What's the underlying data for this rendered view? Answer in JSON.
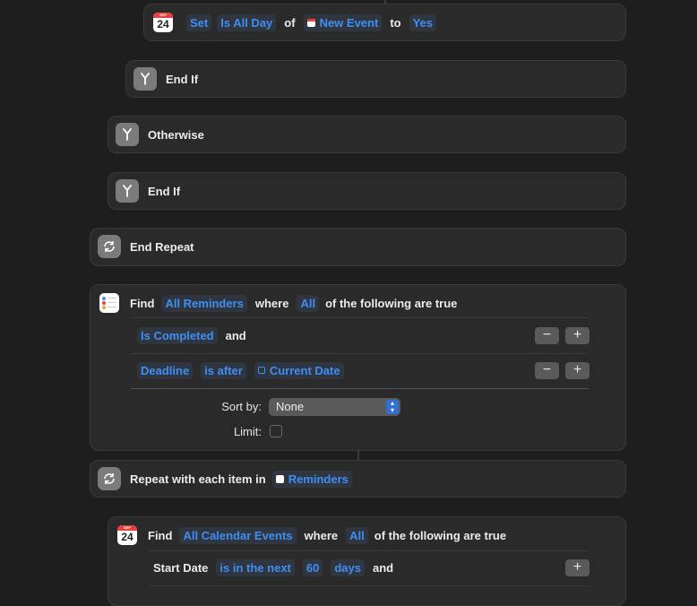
{
  "set_action": {
    "calendar_day": "24",
    "calendar_month": "SEP",
    "set_label": "Set",
    "param": "Is All Day",
    "of_label": "of",
    "variable": "New Event",
    "to_label": "to",
    "value": "Yes"
  },
  "end_if_inner": {
    "label": "End If",
    "icon": "branch-icon"
  },
  "otherwise": {
    "label": "Otherwise",
    "icon": "branch-icon"
  },
  "end_if_outer": {
    "label": "End If",
    "icon": "branch-icon"
  },
  "end_repeat": {
    "label": "End Repeat",
    "icon": "repeat-icon"
  },
  "find_reminders": {
    "find_label": "Find",
    "entity": "All Reminders",
    "where_label": "where",
    "quantifier": "All",
    "suffix": "of the following are true",
    "filters": [
      {
        "property": "Is Completed",
        "and_label": "and"
      },
      {
        "property": "Deadline",
        "operator": "is after",
        "value": "Current Date"
      }
    ],
    "minus": "−",
    "plus": "+",
    "sort_by_label": "Sort by:",
    "sort_by_value": "None",
    "limit_label": "Limit:",
    "limit_checked": false
  },
  "repeat_each": {
    "label": "Repeat with each item in",
    "variable": "Reminders",
    "icon": "repeat-icon"
  },
  "find_events": {
    "calendar_day": "24",
    "calendar_month": "SEP",
    "find_label": "Find",
    "entity": "All Calendar Events",
    "where_label": "where",
    "quantifier": "All",
    "suffix": "of the following are true",
    "filter": {
      "property": "Start Date",
      "operator": "is in the next",
      "amount": "60",
      "unit": "days",
      "and_label": "and"
    },
    "plus": "+"
  },
  "colors": {
    "background": "#1e1e1e",
    "card": "#2a2a2a",
    "token_text": "#3f8ef5",
    "calendar_red": "#e8413b"
  }
}
